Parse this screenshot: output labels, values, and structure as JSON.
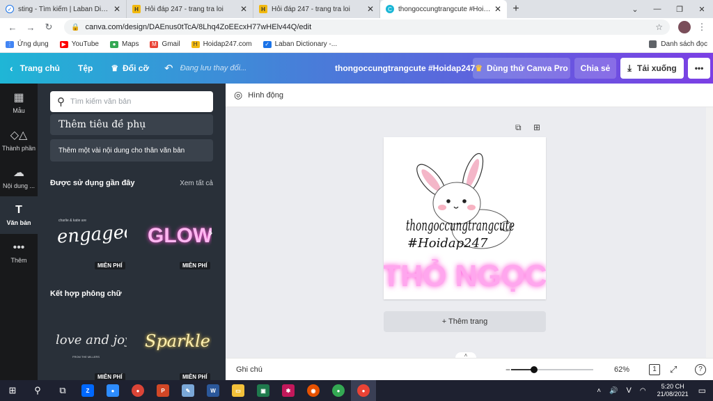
{
  "browser": {
    "tabs": [
      {
        "title": "sting - Tìm kiếm | Laban Dictiona",
        "icon": "laban-icon",
        "active": false
      },
      {
        "title": "Hỏi đáp 247 - trang tra loi",
        "icon": "hoidap-icon",
        "active": false
      },
      {
        "title": "Hỏi đáp 247 - trang tra loi",
        "icon": "hoidap-icon",
        "active": false
      },
      {
        "title": "thongoccungtrangcute #Hoidap",
        "icon": "canva-icon",
        "active": true
      }
    ],
    "url": "canva.com/design/DAEnus0tTcA/8Lhq4ZoEEcxH77wHElv44Q/edit",
    "bookmarks": [
      "Ứng dụng",
      "YouTube",
      "Maps",
      "Gmail",
      "Hoidap247.com",
      "Laban Dictionary -..."
    ],
    "reading_list": "Danh sách đọc"
  },
  "header": {
    "home": "Trang chủ",
    "file": "Tệp",
    "resize": "Đổi cỡ",
    "saving": "Đang lưu thay đổi...",
    "title": "thongoccungtrangcute #Hoidap247",
    "pro": "Dùng thử Canva Pro",
    "share": "Chia sẻ",
    "download": "Tải xuống"
  },
  "rail": [
    {
      "label": "Mẫu",
      "icon": "template-icon"
    },
    {
      "label": "Thành phần",
      "icon": "elements-icon"
    },
    {
      "label": "Nội dung ...",
      "icon": "upload-icon"
    },
    {
      "label": "Văn bản",
      "icon": "text-icon",
      "active": true
    },
    {
      "label": "Thêm",
      "icon": "more-icon"
    }
  ],
  "panel": {
    "search_placeholder": "Tìm kiếm văn bản",
    "subheading": "Thêm tiêu đề phụ",
    "body": "Thêm một vài nội dung cho thân văn bản",
    "recent_title": "Được sử dụng gần đây",
    "see_all": "Xem tất cả",
    "recent": [
      {
        "caption": "charlie & katie are",
        "text": "engaged!",
        "badge": "MIỄN PHÍ"
      },
      {
        "text": "GLOW",
        "badge": "MIỄN PHÍ"
      }
    ],
    "combos_title": "Kết hợp phông chữ",
    "combos": [
      {
        "text": "love and joy",
        "caption": "FROM THE MILLERS",
        "badge": "MIỄN PHÍ"
      },
      {
        "text": "Sparkle",
        "badge": "MIỄN PHÍ"
      }
    ]
  },
  "workspace": {
    "animate": "Hình động",
    "design": {
      "script_line1": "thongoccungtrangcute",
      "script_line2": "#Hoidap247",
      "neon": "THỎ NGỌC"
    },
    "add_page": "+ Thêm trang"
  },
  "bottom": {
    "notes": "Ghi chú",
    "zoom": "62%",
    "zoom_fraction": 0.28,
    "page_count": "1"
  },
  "taskbar": {
    "time": "5:20 CH",
    "date": "21/08/2021",
    "lang": "V"
  },
  "colors": {
    "neon_pink": "#ff4fd8",
    "neon_gold": "#ffe27a",
    "rail_bg": "#18191b",
    "panel_bg": "#293039"
  }
}
